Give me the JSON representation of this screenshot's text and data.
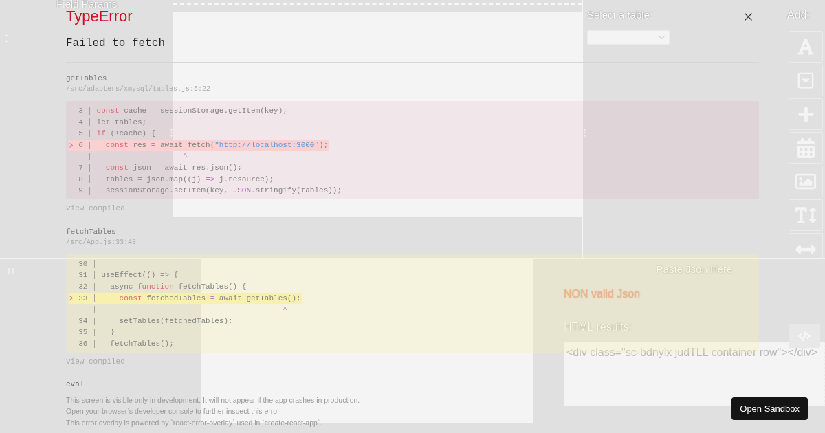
{
  "app": {
    "field_panel": {
      "title": "Field Params"
    },
    "table_picker": {
      "label": "Select a table:"
    },
    "add_panel": {
      "label": "Add:",
      "tools": [
        {
          "kind": "font"
        },
        {
          "kind": "dropdown"
        },
        {
          "kind": "plus"
        },
        {
          "kind": "calendar"
        },
        {
          "kind": "image"
        },
        {
          "kind": "textheight"
        },
        {
          "kind": "width"
        }
      ]
    },
    "json_panel": {
      "prompt": "Paste Json Here",
      "validation": "NON valid Json",
      "results_label": "HTML results:",
      "results_value": "<div class=\"sc-bdnylx judTLL container row\"></div>"
    },
    "sandbox_button": "Open Sandbox"
  },
  "error_overlay": {
    "error_name": "TypeError",
    "message": "Failed to fetch",
    "frames": [
      {
        "kind": "origin",
        "function": "getTables",
        "location": "/src/adapters/xmysql/tables.js:6:22",
        "lines": [
          {
            "kind": "code",
            "number": "3",
            "highlighted": false,
            "code": [
              {
                "kind": "keyword",
                "text": "const"
              },
              {
                "kind": "plain",
                "text": " cache "
              },
              {
                "kind": "operator",
                "text": "="
              },
              {
                "kind": "plain",
                "text": " sessionStorage.getItem(key);"
              }
            ]
          },
          {
            "kind": "code",
            "number": "4",
            "highlighted": false,
            "code": [
              {
                "kind": "plain",
                "text": "let tables;"
              }
            ]
          },
          {
            "kind": "code",
            "number": "5",
            "highlighted": false,
            "code": [
              {
                "kind": "keyword",
                "text": "if"
              },
              {
                "kind": "plain",
                "text": " (!cache) {"
              }
            ]
          },
          {
            "kind": "code",
            "number": "6",
            "highlighted": true,
            "code": [
              {
                "kind": "keyword",
                "text": "  const"
              },
              {
                "kind": "plain",
                "text": " res "
              },
              {
                "kind": "operator",
                "text": "="
              },
              {
                "kind": "plain",
                "text": " await fetch("
              },
              {
                "kind": "string",
                "text": "\"http://localhost:3000\""
              },
              {
                "kind": "plain",
                "text": ");"
              }
            ]
          },
          {
            "kind": "caret",
            "text": "                   ^"
          },
          {
            "kind": "code",
            "number": "7",
            "highlighted": false,
            "code": [
              {
                "kind": "keyword",
                "text": "  const"
              },
              {
                "kind": "plain",
                "text": " json "
              },
              {
                "kind": "operator",
                "text": "="
              },
              {
                "kind": "plain",
                "text": " await res.json();"
              }
            ]
          },
          {
            "kind": "code",
            "number": "8",
            "highlighted": false,
            "code": [
              {
                "kind": "plain",
                "text": "  tables "
              },
              {
                "kind": "operator",
                "text": "="
              },
              {
                "kind": "plain",
                "text": " json.map((j) "
              },
              {
                "kind": "operator",
                "text": "=>"
              },
              {
                "kind": "plain",
                "text": " j.resource);"
              }
            ]
          },
          {
            "kind": "code",
            "number": "9",
            "highlighted": false,
            "code": [
              {
                "kind": "plain",
                "text": "  sessionStorage.setItem(key, "
              },
              {
                "kind": "builtin",
                "text": "JSON"
              },
              {
                "kind": "plain",
                "text": ".stringify(tables));"
              }
            ]
          }
        ],
        "link": "View compiled"
      },
      {
        "kind": "caller",
        "function": "fetchTables",
        "location": "/src/App.js:33:43",
        "lines": [
          {
            "kind": "code",
            "number": "30",
            "highlighted": false
          },
          {
            "kind": "code",
            "number": "31",
            "highlighted": false,
            "code": [
              {
                "kind": "plain",
                "text": "useEffect(() "
              },
              {
                "kind": "operator",
                "text": "=>"
              },
              {
                "kind": "plain",
                "text": " {"
              }
            ]
          },
          {
            "kind": "code",
            "number": "32",
            "highlighted": false,
            "code": [
              {
                "kind": "plain",
                "text": "  async "
              },
              {
                "kind": "keyword",
                "text": "function"
              },
              {
                "kind": "plain",
                "text": " fetchTables() {"
              }
            ]
          },
          {
            "kind": "code",
            "number": "33",
            "highlighted": true,
            "code": [
              {
                "kind": "keyword",
                "text": "    const"
              },
              {
                "kind": "plain",
                "text": " fetchedTables "
              },
              {
                "kind": "operator",
                "text": "="
              },
              {
                "kind": "plain",
                "text": " await getTables();"
              }
            ]
          },
          {
            "kind": "caret",
            "text": "                                        ^"
          },
          {
            "kind": "code",
            "number": "34",
            "highlighted": false,
            "code": [
              {
                "kind": "plain",
                "text": "    setTables(fetchedTables);"
              }
            ]
          },
          {
            "kind": "code",
            "number": "35",
            "highlighted": false,
            "code": [
              {
                "kind": "plain",
                "text": "  }"
              }
            ]
          },
          {
            "kind": "code",
            "number": "36",
            "highlighted": false,
            "code": [
              {
                "kind": "plain",
                "text": "  fetchTables();"
              }
            ]
          }
        ],
        "link": "View compiled"
      }
    ],
    "last_frame": {
      "function": "eval"
    },
    "footer": [
      "This screen is visible only in development. It will not appear if the app crashes in production.",
      "Open your browser’s developer console to further inspect this error.",
      "This error overlay is powered by `react-error-overlay` used in `create-react-app`."
    ]
  }
}
